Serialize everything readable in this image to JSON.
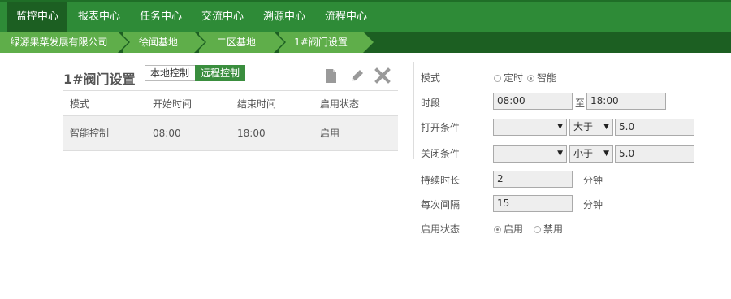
{
  "nav": {
    "tabs": [
      {
        "label": "监控中心",
        "active": true
      },
      {
        "label": "报表中心",
        "active": false
      },
      {
        "label": "任务中心",
        "active": false
      },
      {
        "label": "交流中心",
        "active": false
      },
      {
        "label": "溯源中心",
        "active": false
      },
      {
        "label": "流程中心",
        "active": false
      }
    ]
  },
  "breadcrumb": [
    "绿源果菜发展有限公司",
    "徐闻基地",
    "二区基地",
    "1#阀门设置"
  ],
  "panel": {
    "title": "1#阀门设置",
    "local_label": "本地控制",
    "remote_label": "远程控制"
  },
  "table": {
    "headers": [
      "模式",
      "开始时间",
      "结束时间",
      "启用状态"
    ],
    "rows": [
      [
        "智能控制",
        "08:00",
        "18:00",
        "启用"
      ]
    ]
  },
  "form": {
    "mode_label": "模式",
    "mode_options": [
      "定时",
      "智能"
    ],
    "mode_selected": "智能",
    "period_label": "时段",
    "period_start": "08:00",
    "period_sep": "至",
    "period_end": "18:00",
    "open_label": "打开条件",
    "open_sensor": "",
    "open_op": "大于",
    "open_value": "5.0",
    "close_label": "关闭条件",
    "close_sensor": "",
    "close_op": "小于",
    "close_value": "5.0",
    "duration_label": "持续时长",
    "duration_value": "2",
    "duration_unit": "分钟",
    "interval_label": "每次间隔",
    "interval_value": "15",
    "interval_unit": "分钟",
    "status_label": "启用状态",
    "status_options": [
      "启用",
      "禁用"
    ],
    "status_selected": "启用"
  },
  "colors": {
    "nav_green": "#2e8b37",
    "nav_active": "#1c5f22",
    "crumb_green": "#5fae4a",
    "button_green": "#3a8e3e"
  }
}
